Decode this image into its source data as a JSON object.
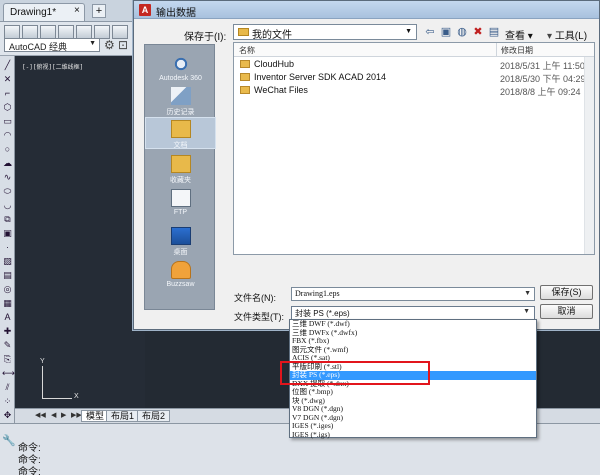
{
  "acad": {
    "tab_title": "Drawing1*",
    "tab_close": "×",
    "tab_add": "+",
    "workspace": "AutoCAD 经典",
    "viewport_label": "[-][俯视][二维线框]",
    "ucs_y": "Y",
    "ucs_x": "X",
    "layout_tabs": [
      "模型",
      "布局1",
      "布局2"
    ],
    "command_lines": [
      "命令:",
      "命令:",
      "命令:"
    ]
  },
  "dialog": {
    "title": "输出数据",
    "save_in_label": "保存于(I):",
    "save_in_value": "我的文件",
    "view_menu": "查看",
    "tools_menu": "工具(L)",
    "places": [
      "Autodesk 360",
      "历史记录",
      "文档",
      "收藏夹",
      "FTP",
      "桌面",
      "Buzzsaw"
    ],
    "columns": {
      "name": "名称",
      "date": "修改日期"
    },
    "files": [
      {
        "name": "CloudHub",
        "date": "2018/5/31 上午 11:50"
      },
      {
        "name": "Inventor Server SDK ACAD 2014",
        "date": "2018/5/30 下午 04:29"
      },
      {
        "name": "WeChat Files",
        "date": "2018/8/8 上午 09:24"
      }
    ],
    "filename_label": "文件名(N):",
    "filename_value": "Drawing1.eps",
    "filetype_label": "文件类型(T):",
    "filetype_value": "封装 PS (*.eps)",
    "save_button": "保存(S)",
    "cancel_button": "取消",
    "filetype_options": [
      "三维 DWF (*.dwf)",
      "三维 DWFx (*.dwfx)",
      "FBX (*.fbx)",
      "图元文件 (*.wmf)",
      "ACIS (*.sat)",
      "平版印刷 (*.stl)",
      "封装 PS (*.eps)",
      "DXX 提取 (*.dxx)",
      "位图 (*.bmp)",
      "块 (*.dwg)",
      "V8 DGN (*.dgn)",
      "V7 DGN (*.dgn)",
      "IGES (*.iges)",
      "IGES (*.igs)"
    ],
    "selected_option_index": 6
  },
  "colors": {
    "selection": "#3399ff",
    "highlight_box": "#e2151c",
    "drawing_bg": "#252c36"
  }
}
